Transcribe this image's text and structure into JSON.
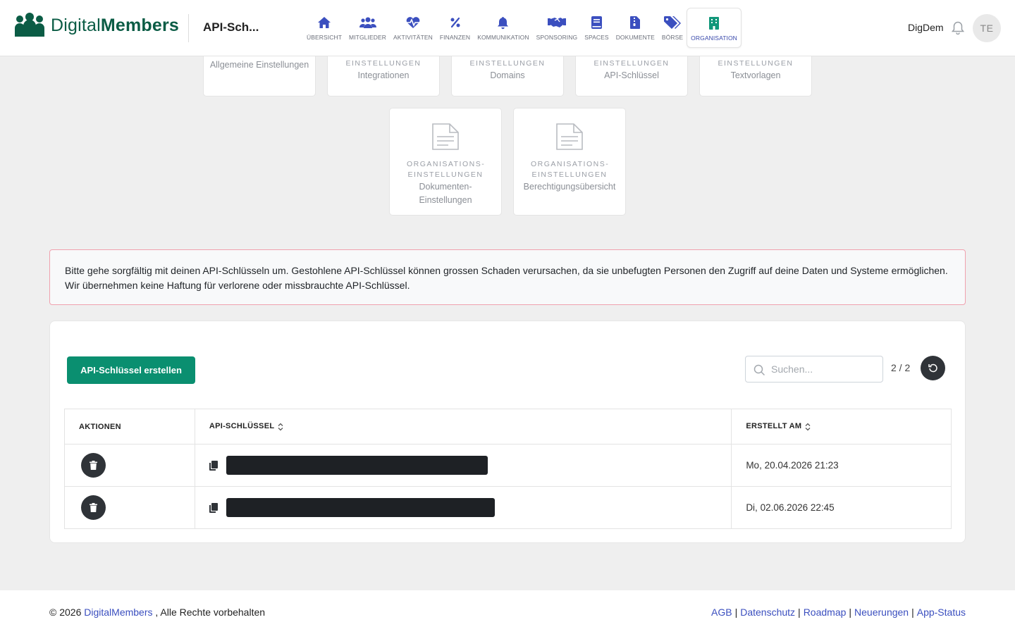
{
  "header": {
    "brand_part1": "Digital",
    "brand_part2": "Members",
    "page_title": "API-Sch...",
    "user_name": "DigDem",
    "avatar_initials": "TE",
    "nav": [
      {
        "label": "Übersicht",
        "icon": "home-icon"
      },
      {
        "label": "Mitglieder",
        "icon": "users-icon"
      },
      {
        "label": "Aktivitäten",
        "icon": "heartbeat-icon"
      },
      {
        "label": "Finanzen",
        "icon": "percent-icon"
      },
      {
        "label": "Kommunikation",
        "icon": "bell-icon"
      },
      {
        "label": "Sponsoring",
        "icon": "handshake-icon"
      },
      {
        "label": "Spaces",
        "icon": "book-icon"
      },
      {
        "label": "Dokumente",
        "icon": "file-zip-icon"
      },
      {
        "label": "Börse",
        "icon": "tags-icon"
      },
      {
        "label": "Organisation",
        "icon": "building-icon",
        "active": true
      }
    ]
  },
  "settings_tiles": {
    "row1": [
      {
        "category": "",
        "name": "Allgemeine Einstellungen"
      },
      {
        "category": "Einstellungen",
        "name": "Integrationen"
      },
      {
        "category": "Einstellungen",
        "name": "Domains"
      },
      {
        "category": "Einstellungen",
        "name": "API-Schlüssel"
      },
      {
        "category": "Einstellungen",
        "name": "Textvorlagen"
      }
    ],
    "row2": [
      {
        "category": "Organisations-Einstellungen",
        "name": "Dokumenten-Einstellungen"
      },
      {
        "category": "Organisations-Einstellungen",
        "name": "Berechtigungsübersicht"
      }
    ]
  },
  "warning_text": "Bitte gehe sorgfältig mit deinen API-Schlüsseln um. Gestohlene API-Schlüssel können grossen Schaden verursachen, da sie unbefugten Personen den Zugriff auf deine Daten und Systeme ermöglichen. Wir übernehmen keine Haftung für verlorene oder missbrauchte API-Schlüssel.",
  "toolbar": {
    "create_label": "API-Schlüssel erstellen",
    "search_placeholder": "Suchen...",
    "pager": "2 / 2"
  },
  "table": {
    "columns": [
      "Aktionen",
      "API-Schlüssel",
      "Erstellt am"
    ],
    "rows": [
      {
        "key": "[redacted]",
        "created": "Mo, 20.04.2026 21:23"
      },
      {
        "key": "[redacted]",
        "created": "Di, 02.06.2026 22:45"
      }
    ]
  },
  "footer": {
    "copyright_prefix": "© 2026",
    "copyright_link": "DigitalMembers",
    "copyright_suffix": ", Alle Rechte vorbehalten",
    "links": [
      "AGB",
      "Datenschutz",
      "Roadmap",
      "Neuerungen",
      "App-Status"
    ]
  },
  "colors": {
    "brand_green": "#0b5c45",
    "primary_button": "#0a8f70",
    "nav_icon": "#3b4fbf",
    "active_nav_icon": "#12977a",
    "warning_border": "#f0a1ae",
    "link": "#3b4fbf"
  }
}
